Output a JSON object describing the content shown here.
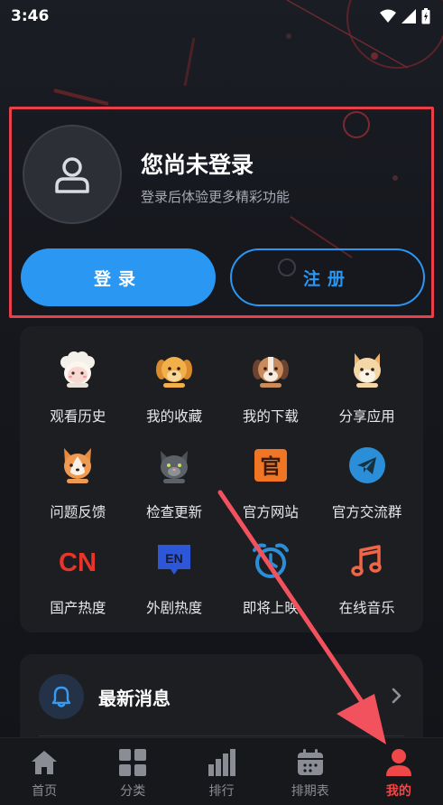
{
  "status_bar": {
    "time": "3:46"
  },
  "profile": {
    "title": "您尚未登录",
    "subtitle": "登录后体验更多精彩功能",
    "login_label": "登录",
    "register_label": "注册"
  },
  "grid": {
    "items": [
      {
        "label": "观看历史",
        "icon": "sheep-icon"
      },
      {
        "label": "我的收藏",
        "icon": "golden-dog-icon"
      },
      {
        "label": "我的下载",
        "icon": "beagle-icon"
      },
      {
        "label": "分享应用",
        "icon": "shiba-icon"
      },
      {
        "label": "问题反馈",
        "icon": "corgi-icon"
      },
      {
        "label": "检查更新",
        "icon": "cat-icon"
      },
      {
        "label": "官方网站",
        "icon": "guan-icon",
        "glyph": "官"
      },
      {
        "label": "官方交流群",
        "icon": "telegram-icon"
      },
      {
        "label": "国产热度",
        "icon": "cn-icon",
        "glyph": "CN"
      },
      {
        "label": "外剧热度",
        "icon": "en-icon",
        "glyph": "EN"
      },
      {
        "label": "即将上映",
        "icon": "alarm-clock-icon"
      },
      {
        "label": "在线音乐",
        "icon": "music-note-icon"
      }
    ]
  },
  "news": {
    "title": "最新消息"
  },
  "nav": {
    "items": [
      {
        "label": "首页",
        "icon": "home-icon"
      },
      {
        "label": "分类",
        "icon": "category-grid-icon"
      },
      {
        "label": "排行",
        "icon": "bar-chart-icon"
      },
      {
        "label": "排期表",
        "icon": "calendar-icon"
      },
      {
        "label": "我的",
        "icon": "user-icon"
      }
    ],
    "active_index": 4
  },
  "colors": {
    "accent": "#2a97f2",
    "active_nav": "#f04848",
    "highlight_box": "#e8404a"
  }
}
